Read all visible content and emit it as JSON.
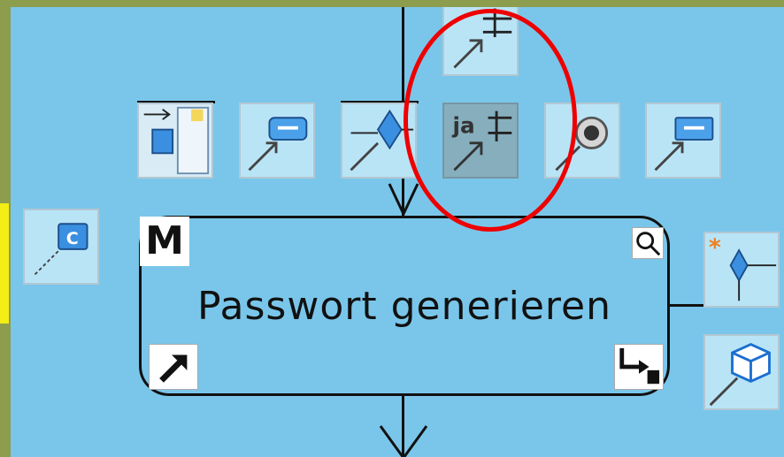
{
  "activity": {
    "label": "Passwort generieren",
    "marker": "M"
  },
  "icons": {
    "left_panel": "class-icon",
    "top_row": [
      "swimlane-icon",
      "message-icon",
      "decision-icon",
      "java-action-icon",
      "end-event-icon",
      "message-icon"
    ],
    "top_single": "merge-icon",
    "right_panel": [
      "merge-decision-icon",
      "component-icon"
    ],
    "badges": [
      "search-icon",
      "link-arrow-icon",
      "subprocess-icon"
    ]
  },
  "colors": {
    "canvas": "#7ac6ea",
    "outer_frame": "#8c9d4e",
    "highlight_oval": "#e00000",
    "selection_bar": "#f3ee15"
  }
}
